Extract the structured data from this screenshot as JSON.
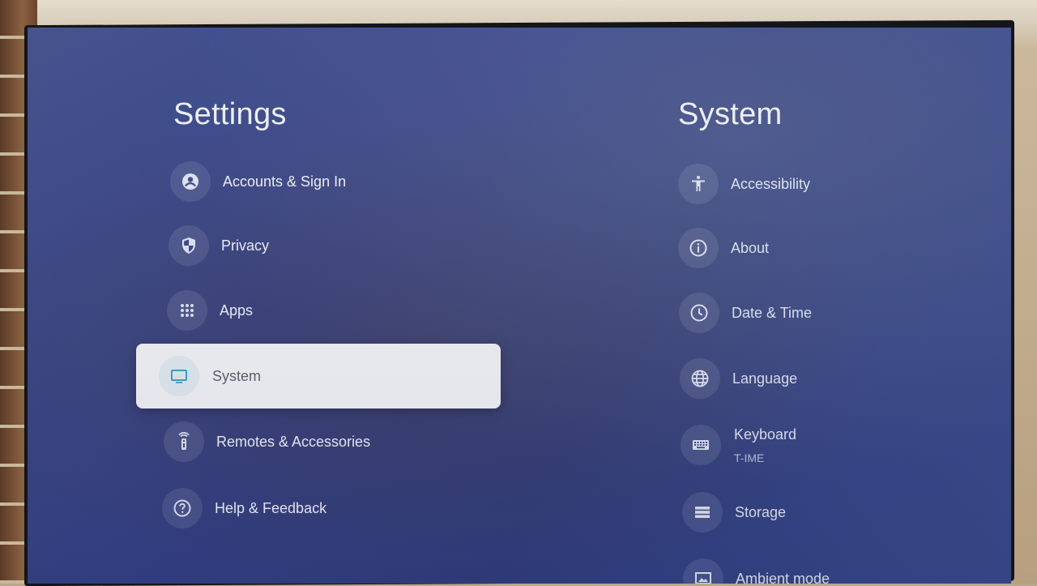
{
  "left_panel": {
    "title": "Settings",
    "items": [
      {
        "label": "Accounts & Sign In",
        "icon": "account-circle-icon"
      },
      {
        "label": "Privacy",
        "icon": "shield-icon"
      },
      {
        "label": "Apps",
        "icon": "apps-grid-icon"
      },
      {
        "label": "System",
        "icon": "tv-icon",
        "selected": true
      },
      {
        "label": "Remotes & Accessories",
        "icon": "remote-icon"
      },
      {
        "label": "Help & Feedback",
        "icon": "help-icon"
      }
    ]
  },
  "right_panel": {
    "title": "System",
    "items": [
      {
        "label": "Accessibility",
        "icon": "accessibility-icon"
      },
      {
        "label": "About",
        "icon": "info-icon"
      },
      {
        "label": "Date & Time",
        "icon": "clock-icon"
      },
      {
        "label": "Language",
        "icon": "globe-icon"
      },
      {
        "label": "Keyboard",
        "sublabel": "T-IME",
        "icon": "keyboard-icon"
      },
      {
        "label": "Storage",
        "icon": "storage-icon"
      },
      {
        "label": "Ambient mode",
        "icon": "ambient-mode-icon"
      }
    ]
  },
  "colors": {
    "screen_background": "#34418a",
    "selected_card": "#f1f3f8",
    "text_primary": "#eef1fb"
  }
}
